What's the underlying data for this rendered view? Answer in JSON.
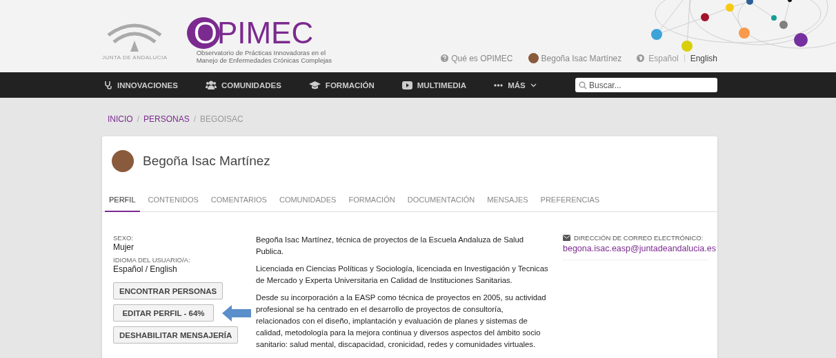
{
  "header": {
    "government_logo": "JUNTA DE ANDALUCIA",
    "site_logo": "OPIMEC",
    "tagline": [
      "Observatorio de Prácticas Innovadoras en el",
      "Manejo de Enfermedades Crónicas Complejas"
    ],
    "help_link": "Qué es OPIMEC",
    "user_link": "Begoña Isac Martínez",
    "languages": [
      {
        "label": "Español",
        "selected": false
      },
      {
        "label": "English",
        "selected": true
      }
    ]
  },
  "nav": {
    "items": [
      {
        "label": "INNOVACIONES",
        "kind": "stethoscope"
      },
      {
        "label": "COMUNIDADES",
        "kind": "users"
      },
      {
        "label": "FORMACIÓN",
        "kind": "cap"
      },
      {
        "label": "MULTIMEDIA",
        "kind": "play"
      },
      {
        "label": "MÁS",
        "kind": "more"
      }
    ],
    "search": {
      "placeholder": "Buscar..."
    }
  },
  "breadcrumb": {
    "separator": "/",
    "items": [
      {
        "label": "INICIO",
        "link": true
      },
      {
        "label": "PERSONAS",
        "link": true
      },
      {
        "label": "BEGOISAC",
        "link": false
      }
    ]
  },
  "profile": {
    "name": "Begoña Isac Martínez",
    "tabs": [
      {
        "label": "PERFIL",
        "selected": true
      },
      {
        "label": "CONTENIDOS",
        "selected": false
      },
      {
        "label": "COMENTARIOS",
        "selected": false
      },
      {
        "label": "COMUNIDADES",
        "selected": false
      },
      {
        "label": "FORMACIÓN",
        "selected": false
      },
      {
        "label": "DOCUMENTACIÓN",
        "selected": false
      },
      {
        "label": "MENSAJES",
        "selected": false
      },
      {
        "label": "PREFERENCIAS",
        "selected": false
      }
    ],
    "fields": [
      {
        "label": "SEXO:",
        "value": "Mujer"
      },
      {
        "label": "IDIOMA DEL USUARIO/A:",
        "value": "Español / English"
      }
    ],
    "buttons": [
      "ENCONTRAR PERSONAS",
      "EDITAR PERFIL - 64%",
      "DESHABILITAR MENSAJERÍA"
    ],
    "bio": [
      "Begoña Isac Martínez, técnica de proyectos de la Escuela Andaluza de Salud Publica.",
      "Licenciada en Ciencias Políticas y Sociología, licenciada en Investigación y Tecnicas de Mercado y Experta Universitaria en Calidad de Instituciones Sanitarias.",
      "Desde su incorporación a la EASP como técnica de proyectos en 2005, su actividad profesional se ha centrado en el desarrollo de proyectos de consultoría, relacionados con el diseño, implantación y evaluación de planes y sistemas de calidad, metodología para la mejora continua y diversos aspectos del ámbito socio sanitario: salud mental, discapacidad, cronicidad, redes y comunidades virtuales."
    ],
    "email_label": "DIRECCIÓN DE CORREO ELECTRÓNICO:",
    "email": "begona.isac.easp@juntadeandalucia.es"
  }
}
